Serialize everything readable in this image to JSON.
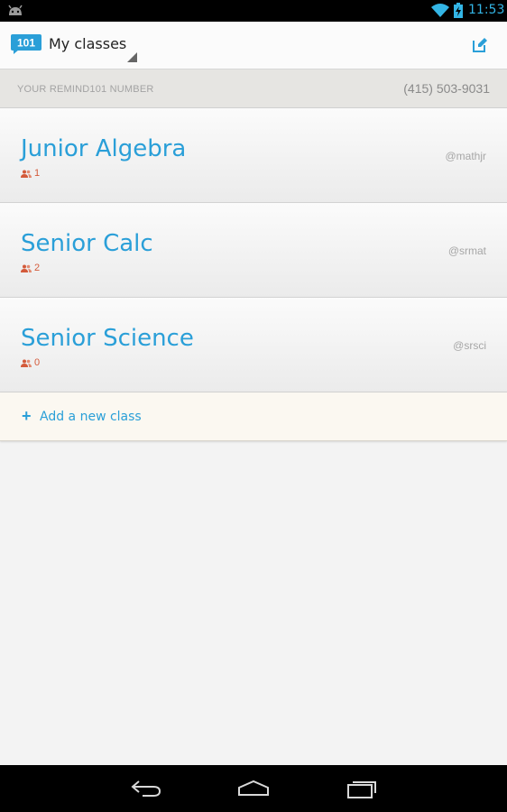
{
  "status_bar": {
    "time": "11:53",
    "icons": [
      "android-icon",
      "wifi-icon",
      "battery-charging-icon"
    ],
    "accent_color": "#33b5e5"
  },
  "action_bar": {
    "logo_text": "101",
    "title": "My classes",
    "compose_icon": "compose-icon"
  },
  "number_bar": {
    "label": "YOUR REMIND101 NUMBER",
    "number": "(415) 503-9031"
  },
  "classes": [
    {
      "name": "Junior Algebra",
      "members": "1",
      "handle": "@mathjr"
    },
    {
      "name": "Senior Calc",
      "members": "2",
      "handle": "@srmat"
    },
    {
      "name": "Senior Science",
      "members": "0",
      "handle": "@srsci"
    }
  ],
  "add_class": {
    "icon": "plus-icon",
    "label": "Add a new class"
  },
  "nav_bar": {
    "icons": [
      "back-icon",
      "home-icon",
      "recents-icon"
    ]
  },
  "colors": {
    "brand_blue": "#2a9fd8",
    "member_count": "#d35a3a"
  }
}
